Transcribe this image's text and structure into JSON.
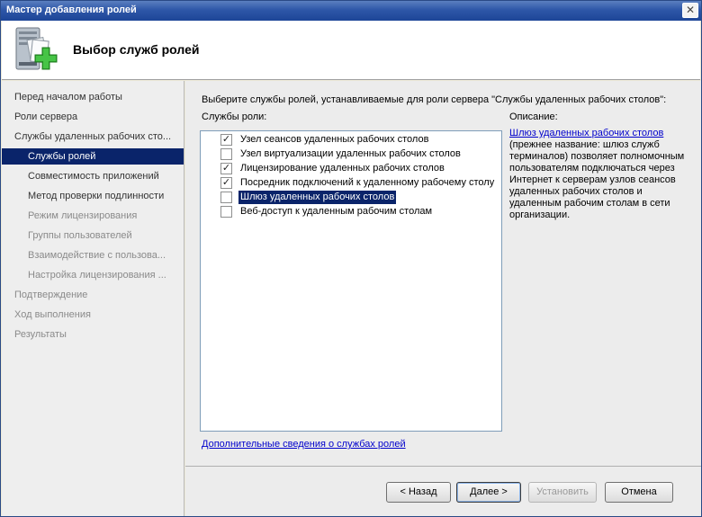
{
  "window": {
    "title": "Мастер добавления ролей",
    "close_glyph": "✕"
  },
  "header": {
    "title": "Выбор служб ролей",
    "icon": "server-roles-add-icon"
  },
  "nav": {
    "items": [
      {
        "label": "Перед началом работы",
        "state": "done"
      },
      {
        "label": "Роли сервера",
        "state": "done"
      },
      {
        "label": "Службы удаленных рабочих сто...",
        "state": "done"
      },
      {
        "label": "Службы ролей",
        "state": "active"
      },
      {
        "label": "Совместимость приложений",
        "state": "done"
      },
      {
        "label": "Метод проверки подлинности",
        "state": "done"
      },
      {
        "label": "Режим лицензирования",
        "state": "disabled"
      },
      {
        "label": "Группы пользователей",
        "state": "disabled"
      },
      {
        "label": "Взаимодействие с пользова...",
        "state": "disabled"
      },
      {
        "label": "Настройка лицензирования ...",
        "state": "disabled"
      },
      {
        "label": "Подтверждение",
        "state": "disabled"
      },
      {
        "label": "Ход выполнения",
        "state": "disabled"
      },
      {
        "label": "Результаты",
        "state": "disabled"
      }
    ]
  },
  "main": {
    "instruction": "Выберите службы ролей, устанавливаемые для роли сервера \"Службы удаленных рабочих столов\":",
    "list_label": "Службы роли:",
    "services": [
      {
        "label": "Узел сеансов удаленных рабочих столов",
        "checked": true
      },
      {
        "label": "Узел виртуализации удаленных рабочих столов",
        "checked": false
      },
      {
        "label": "Лицензирование удаленных рабочих столов",
        "checked": true
      },
      {
        "label": "Посредник подключений к удаленному рабочему столу",
        "checked": true
      },
      {
        "label": "Шлюз удаленных рабочих столов",
        "checked": false,
        "selected": true
      },
      {
        "label": "Веб-доступ к удаленным рабочим столам",
        "checked": false
      }
    ],
    "check_glyph": "✓",
    "description_label": "Описание:",
    "description_link": "Шлюз удаленных рабочих столов",
    "description_text": "(прежнее название: шлюз служб терминалов) позволяет полномочным пользователям подключаться через Интернет к серверам узлов сеансов удаленных рабочих столов и удаленным рабочим столам в сети организации.",
    "more_info_link": "Дополнительные сведения о службах ролей"
  },
  "footer": {
    "back": "< Назад",
    "next": "Далее >",
    "install": "Установить",
    "cancel": "Отмена"
  }
}
